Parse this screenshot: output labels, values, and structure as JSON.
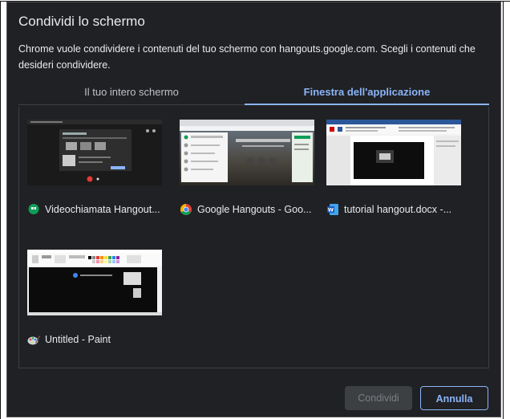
{
  "dialog": {
    "title": "Condividi lo schermo",
    "description": "Chrome vuole condividere i contenuti del tuo schermo con hangouts.google.com. Scegli i contenuti che desideri condividere."
  },
  "tabs": [
    {
      "label": "Il tuo intero schermo",
      "selected": false
    },
    {
      "label": "Finestra dell'applicazione",
      "selected": true
    }
  ],
  "windows": [
    {
      "label": "Videochiamata Hangout...",
      "icon": "hangouts-icon"
    },
    {
      "label": "Google Hangouts - Goo...",
      "icon": "chrome-icon"
    },
    {
      "label": "tutorial hangout.docx -...",
      "icon": "word-icon"
    },
    {
      "label": "Untitled - Paint",
      "icon": "paint-icon"
    }
  ],
  "buttons": {
    "share": "Condividi",
    "cancel": "Annulla"
  },
  "colors": {
    "accent": "#8ab4f8",
    "background": "#202124",
    "text": "#e8eaed"
  }
}
